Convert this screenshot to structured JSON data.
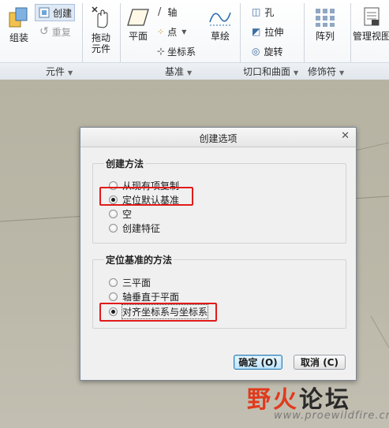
{
  "ribbon": {
    "groups": [
      {
        "label": "元件"
      },
      {
        "label": "基准"
      },
      {
        "label": "切口和曲面"
      },
      {
        "label": "修饰符"
      }
    ],
    "buttons": {
      "group": "组装",
      "create": "创建",
      "redo": "重复",
      "drag": "拖动\n元件",
      "drag_l1": "拖动",
      "drag_l2": "元件",
      "plane": "平面",
      "axis": "轴",
      "point": "点",
      "coord": "坐标系",
      "sketch": "草绘",
      "hole": "孔",
      "extrude": "拉伸",
      "revolve": "旋转",
      "pattern": "阵列",
      "manage_view": "管理视图"
    }
  },
  "dialog": {
    "title": "创建选项",
    "section1": {
      "legend": "创建方法",
      "options": [
        {
          "label": "从现有项复制",
          "checked": false
        },
        {
          "label": "定位默认基准",
          "checked": true
        },
        {
          "label": "空",
          "checked": false
        },
        {
          "label": "创建特征",
          "checked": false
        }
      ]
    },
    "section2": {
      "legend": "定位基准的方法",
      "options": [
        {
          "label": "三平面",
          "checked": false
        },
        {
          "label": "轴垂直于平面",
          "checked": false
        },
        {
          "label": "对齐坐标系与坐标系",
          "checked": true
        }
      ]
    },
    "ok_label": "确定 (O)",
    "cancel_label": "取消 (C)"
  },
  "watermark": {
    "brand_a": "野火",
    "brand_b": "论坛",
    "url": "www.proewildfire.cn"
  },
  "colors": {
    "highlight": "#e21a1a",
    "viewport": "#b9b5a5",
    "brand": "#e03a1c"
  }
}
